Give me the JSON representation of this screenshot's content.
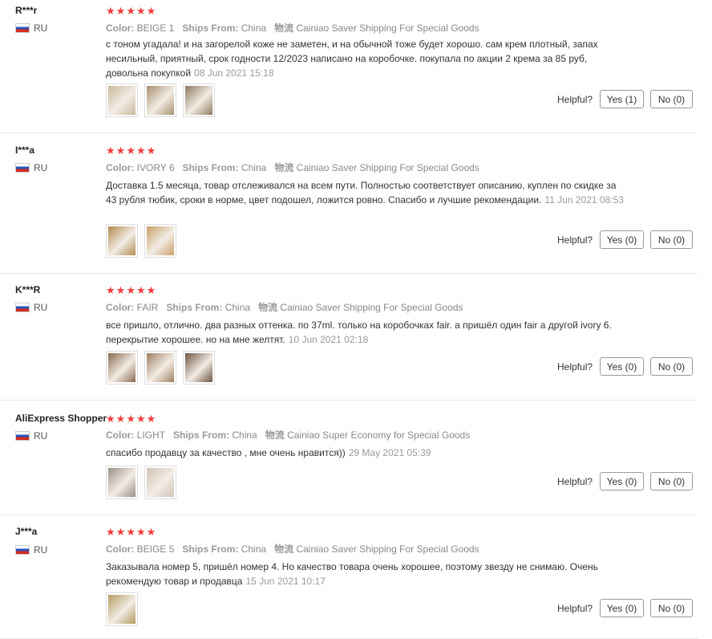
{
  "labels": {
    "color": "Color:",
    "ships_from": "Ships From:",
    "logistics": "物流",
    "helpful": "Helpful?"
  },
  "colors": {
    "star": "#f23c3c",
    "muted": "#999999",
    "divider": "#e8e8e8"
  },
  "reviews": [
    {
      "user": "R***r",
      "country": "RU",
      "rating": 5,
      "color": "BEIGE 1",
      "ships_from": "China",
      "shipping": "Cainiao Saver Shipping For Special Goods",
      "text": "с тоном угадала! и на загорелой коже не заметен, и на обычной тоже будет хорошо. сам крем плотный, запах несильный, приятный, срок годности 12/2023 написано на коробочке. покупала по акции 2 крема за 85 руб, довольна покупкой",
      "date": "08 Jun 2021 15:18",
      "photos": 3,
      "yes": "Yes (1)",
      "no": "No (0)"
    },
    {
      "user": "I***a",
      "country": "RU",
      "rating": 5,
      "color": "IVORY 6",
      "ships_from": "China",
      "shipping": "Cainiao Saver Shipping For Special Goods",
      "text": "Доставка 1.5 месяца, товар отслеживался на всем пути. Полностью соответствует описанию, куплен по скидке за 43 рубля тюбик, сроки в норме, цвет подошел, ложится ровно. Спасибо и лучшие рекомендации.",
      "date": "11 Jun 2021 08:53",
      "photos": 2,
      "yes": "Yes (0)",
      "no": "No (0)"
    },
    {
      "user": "K***R",
      "country": "RU",
      "rating": 5,
      "color": "FAIR",
      "ships_from": "China",
      "shipping": "Cainiao Saver Shipping For Special Goods",
      "text": "все пришло, отлично. два разных оттенка. по 37ml. только на коробочках fair. а пришёл один fair а другой ivory 6. перекрытие хорошее. но на мне желтят.",
      "date": "10 Jun 2021 02:18",
      "photos": 3,
      "yes": "Yes (0)",
      "no": "No (0)"
    },
    {
      "user": "AliExpress Shopper",
      "country": "RU",
      "rating": 5,
      "color": "LIGHT",
      "ships_from": "China",
      "shipping": "Cainiao Super Economy for Special Goods",
      "text": "спасибо продавцу за качество , мне очень нравится))",
      "date": "29 May 2021 05:39",
      "photos": 2,
      "yes": "Yes (0)",
      "no": "No (0)"
    },
    {
      "user": "J***a",
      "country": "RU",
      "rating": 5,
      "color": "BEIGE 5",
      "ships_from": "China",
      "shipping": "Cainiao Saver Shipping For Special Goods",
      "text": "Заказывала номер 5, пришёл номер 4. Но качество товара очень хорошее, поэтому звезду не снимаю. Очень рекомендую товар и продавца",
      "date": "15 Jun 2021 10:17",
      "photos": 1,
      "yes": "Yes (0)",
      "no": "No (0)"
    }
  ]
}
